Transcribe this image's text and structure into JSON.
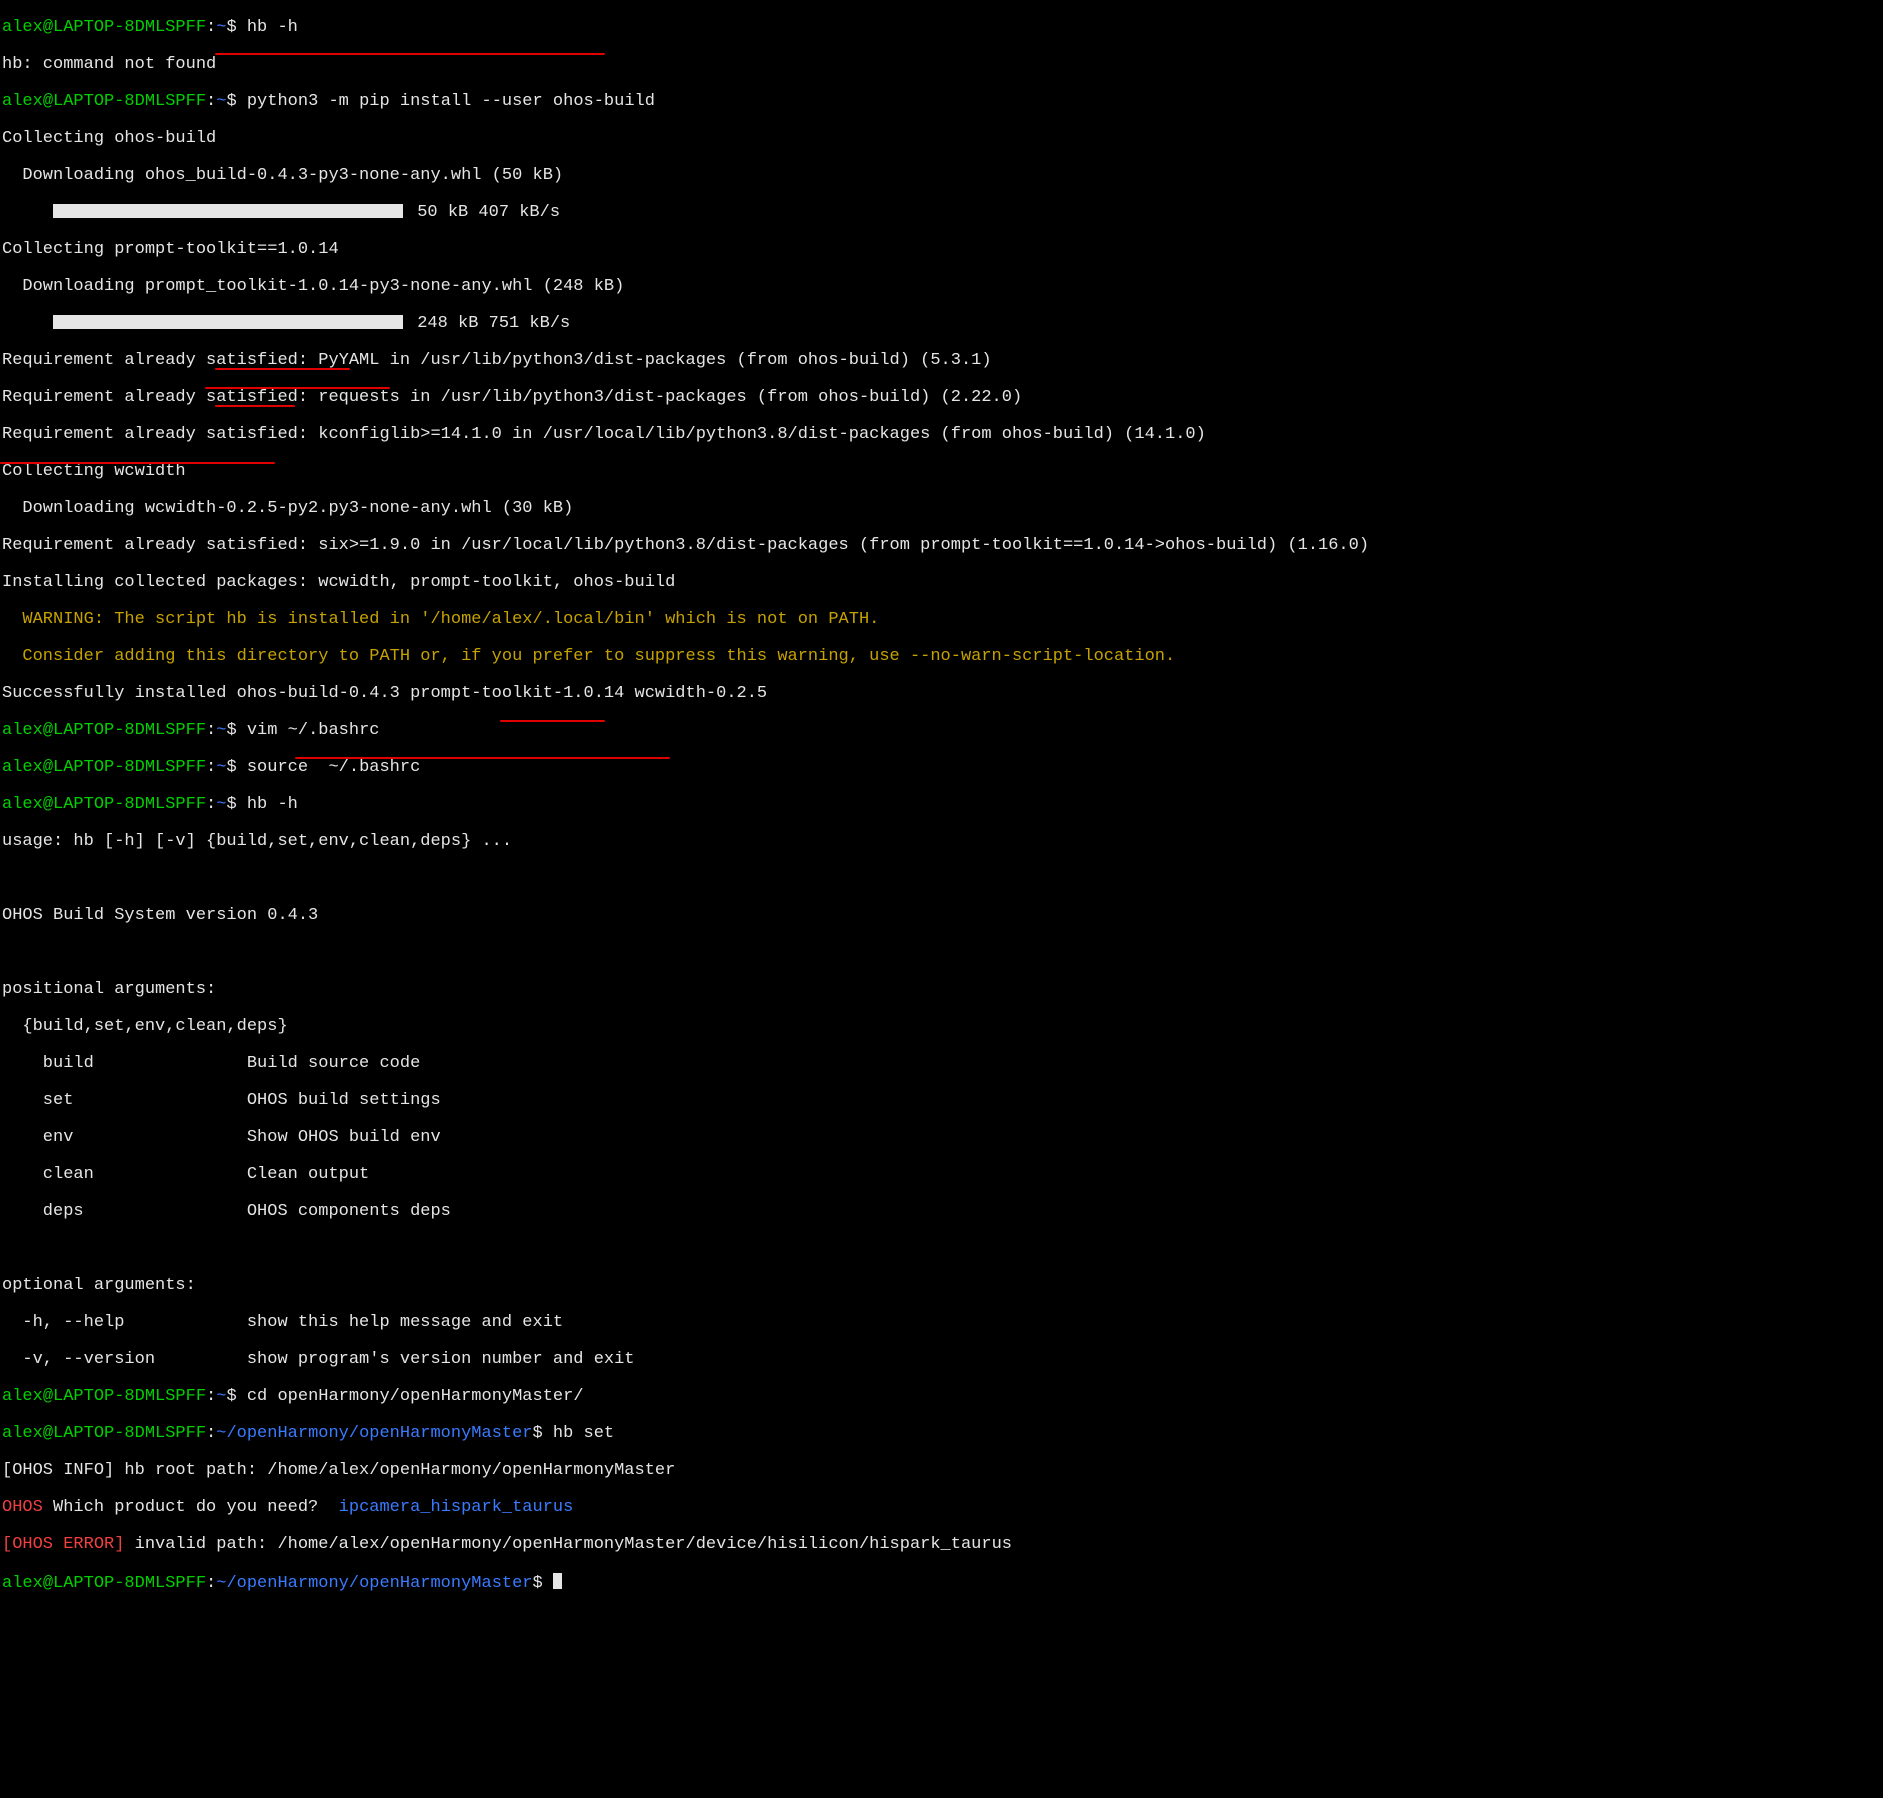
{
  "prompt": {
    "user": "alex",
    "host": "LAPTOP-8DMLSPFF",
    "sep1": "@",
    "sep2": ":",
    "home_path": "~",
    "work_path": "~/openHarmony/openHarmonyMaster",
    "dollar": "$ "
  },
  "cmds": {
    "hb_h": "hb -h",
    "pip_install": "python3 -m pip install --user ohos-build",
    "vim_bashrc": "vim ~/.bashrc",
    "source_bashrc": "source  ~/.bashrc",
    "hb_h2": "hb -h",
    "cd_ohm": "cd openHarmony/openHarmonyMaster/",
    "hb_set": "hb set"
  },
  "out": {
    "not_found": "hb: command not found",
    "collect_ohos": "Collecting ohos-build",
    "dl_ohos": "  Downloading ohos_build-0.4.3-py3-none-any.whl (50 kB)",
    "dl_ohos_prog_pre": "     ",
    "dl_ohos_prog_post": " 50 kB 407 kB/s",
    "collect_pt": "Collecting prompt-toolkit==1.0.14",
    "dl_pt": "  Downloading prompt_toolkit-1.0.14-py3-none-any.whl (248 kB)",
    "dl_pt_prog_pre": "     ",
    "dl_pt_prog_post": " 248 kB 751 kB/s",
    "req_pyyaml": "Requirement already satisfied: PyYAML in /usr/lib/python3/dist-packages (from ohos-build) (5.3.1)",
    "req_requests": "Requirement already satisfied: requests in /usr/lib/python3/dist-packages (from ohos-build) (2.22.0)",
    "req_kconfig": "Requirement already satisfied: kconfiglib>=14.1.0 in /usr/local/lib/python3.8/dist-packages (from ohos-build) (14.1.0)",
    "collect_wc": "Collecting wcwidth",
    "dl_wc": "  Downloading wcwidth-0.2.5-py2.py3-none-any.whl (30 kB)",
    "req_six": "Requirement already satisfied: six>=1.9.0 in /usr/local/lib/python3.8/dist-packages (from prompt-toolkit==1.0.14->ohos-build) (1.16.0)",
    "installing": "Installing collected packages: wcwidth, prompt-toolkit, ohos-build",
    "warn1": "  WARNING: The script hb is installed in '/home/alex/.local/bin' which is not on PATH.",
    "warn2": "  Consider adding this directory to PATH or, if you prefer to suppress this warning, use --no-warn-script-location.",
    "success": "Successfully installed ohos-build-0.4.3 prompt-toolkit-1.0.14 wcwidth-0.2.5",
    "usage": "usage: hb [-h] [-v] {build,set,env,clean,deps} ...",
    "blank": "",
    "ohos_ver": "OHOS Build System version 0.4.3",
    "posarg_h": "positional arguments:",
    "posarg_list": "  {build,set,env,clean,deps}",
    "posarg_build": "    build               Build source code",
    "posarg_set": "    set                 OHOS build settings",
    "posarg_env": "    env                 Show OHOS build env",
    "posarg_clean": "    clean               Clean output",
    "posarg_deps": "    deps                OHOS components deps",
    "optarg_h": "optional arguments:",
    "optarg_help": "  -h, --help            show this help message and exit",
    "optarg_ver": "  -v, --version         show program's version number and exit",
    "info_root": "[OHOS INFO] hb root path: /home/alex/openHarmony/openHarmonyMaster",
    "ohos_lbl": "OHOS",
    "ohos_q": " Which product do you need?  ",
    "product": "ipcamera_hispark_taurus",
    "err_lbl": "[OHOS ERROR]",
    "err_msg": " invalid path: /home/alex/openHarmony/openHarmonyMaster/device/hisilicon/hispark_taurus"
  }
}
